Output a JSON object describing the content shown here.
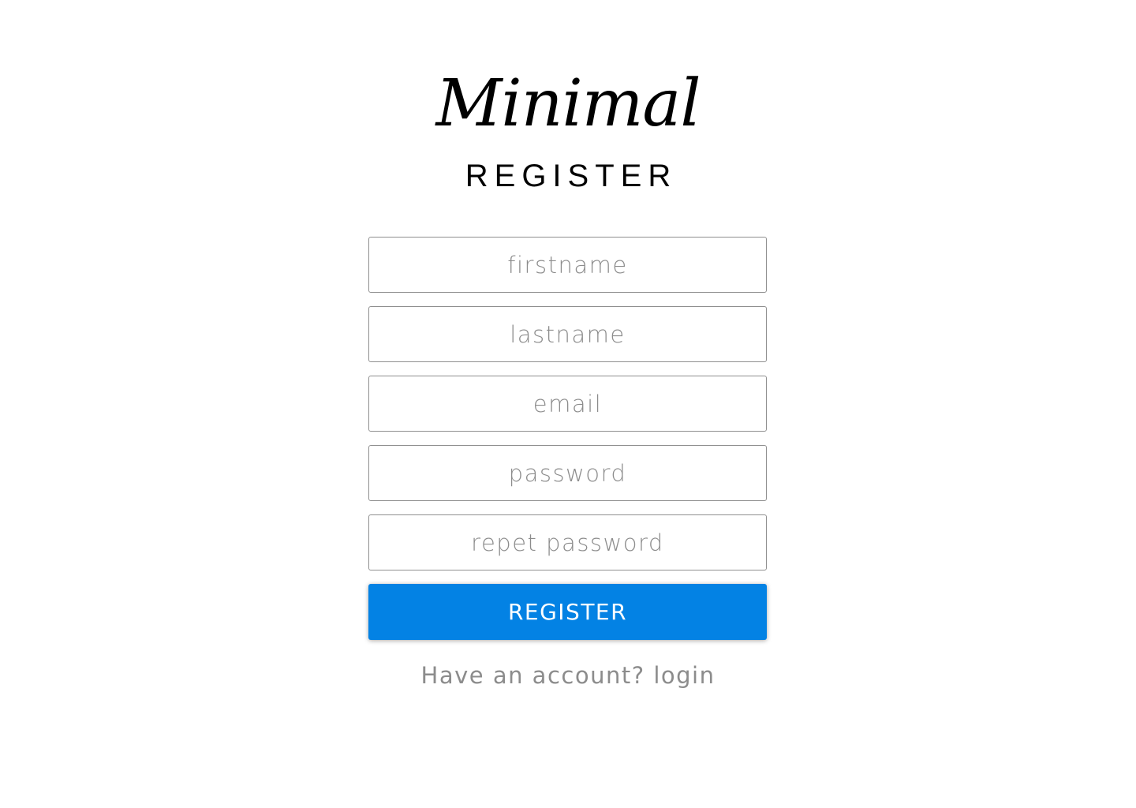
{
  "brand": {
    "logo_text": "Minimal"
  },
  "page": {
    "heading": "REGISTER"
  },
  "form": {
    "fields": [
      {
        "name": "firstname",
        "placeholder": "firstname",
        "value": ""
      },
      {
        "name": "lastname",
        "placeholder": "lastname",
        "value": ""
      },
      {
        "name": "email",
        "placeholder": "email",
        "value": ""
      },
      {
        "name": "password",
        "placeholder": "password",
        "value": ""
      },
      {
        "name": "repeat-password",
        "placeholder": "repet password",
        "value": ""
      }
    ],
    "submit_label": "REGISTER"
  },
  "footer": {
    "prompt_text": "Have an account?",
    "login_link": "login"
  },
  "colors": {
    "accent": "#0382e4",
    "placeholder": "#8c8c8c",
    "border": "#8f8f8f",
    "background": "#ffffff"
  }
}
